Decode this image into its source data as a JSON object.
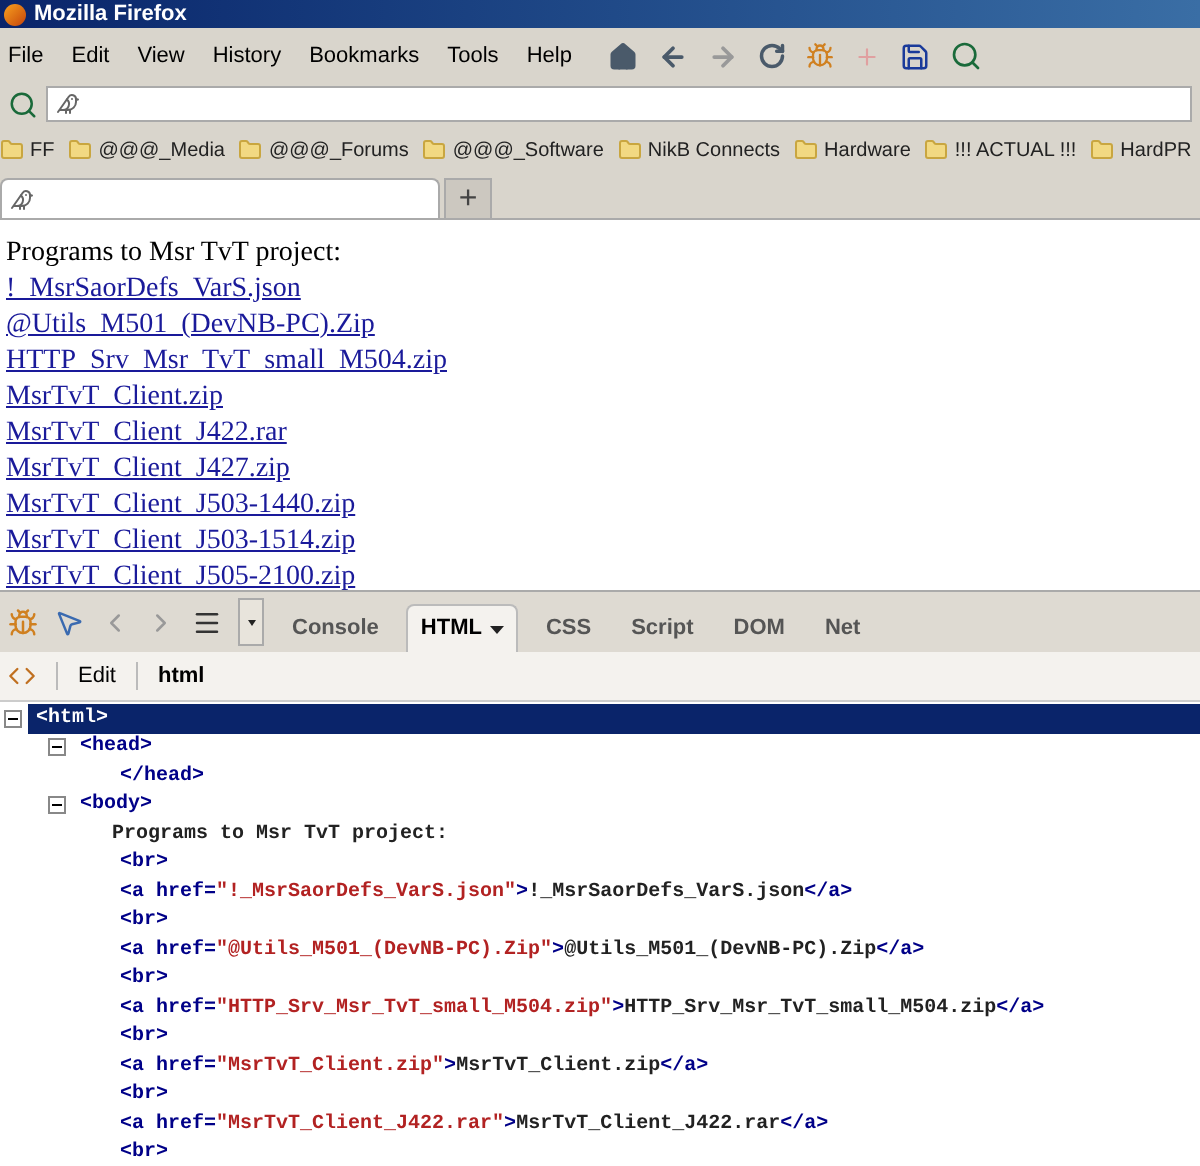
{
  "window": {
    "title": "Mozilla Firefox"
  },
  "menu": [
    "File",
    "Edit",
    "View",
    "History",
    "Bookmarks",
    "Tools",
    "Help"
  ],
  "bookmarks": [
    "FF",
    "@@@_Media",
    "@@@_Forums",
    "@@@_Software",
    "NikB Connects",
    "Hardware",
    "!!! ACTUAL !!!",
    "HardPR"
  ],
  "new_tab": {
    "label": "+"
  },
  "page": {
    "heading": "Programs to Msr TvT project:",
    "links": [
      "!_MsrSaorDefs_VarS.json",
      "@Utils_M501_(DevNB-PC).Zip",
      "HTTP_Srv_Msr_TvT_small_M504.zip",
      "MsrTvT_Client.zip",
      "MsrTvT_Client_J422.rar",
      "MsrTvT_Client_J427.zip",
      "MsrTvT_Client_J503-1440.zip",
      "MsrTvT_Client_J503-1514.zip",
      "MsrTvT_Client_J505-2100.zip"
    ]
  },
  "devtools": {
    "tabs": [
      {
        "label": "Console",
        "selected": false,
        "dropdown": false
      },
      {
        "label": "HTML",
        "selected": true,
        "dropdown": true
      },
      {
        "label": "CSS",
        "selected": false,
        "dropdown": false
      },
      {
        "label": "Script",
        "selected": false,
        "dropdown": false
      },
      {
        "label": "DOM",
        "selected": false,
        "dropdown": false
      },
      {
        "label": "Net",
        "selected": false,
        "dropdown": false
      }
    ],
    "edit_button": "Edit",
    "breadcrumb": "html",
    "tree": [
      {
        "kind": "element",
        "selected": true,
        "expanded": true,
        "line": [
          {
            "kind": "tag",
            "text": "<html>"
          }
        ],
        "children": [
          {
            "kind": "element",
            "selected": false,
            "expanded": true,
            "line": [
              {
                "kind": "tag",
                "text": "<head>"
              }
            ],
            "children": [
              {
                "kind": "leaf",
                "line": [
                  {
                    "kind": "tag",
                    "text": "</head>"
                  }
                ]
              }
            ]
          },
          {
            "kind": "element",
            "selected": false,
            "expanded": true,
            "line": [
              {
                "kind": "tag",
                "text": "<body>"
              }
            ],
            "children": [
              {
                "kind": "text",
                "line": [
                  {
                    "kind": "text",
                    "text": "Programs to Msr TvT project:"
                  }
                ]
              },
              {
                "kind": "leaf",
                "line": [
                  {
                    "kind": "tag",
                    "text": "<br>"
                  }
                ]
              },
              {
                "kind": "leaf",
                "line": [
                  {
                    "kind": "tag",
                    "text": "<a href="
                  },
                  {
                    "kind": "value",
                    "text": "\"!_MsrSaorDefs_VarS.json\""
                  },
                  {
                    "kind": "tag",
                    "text": ">"
                  },
                  {
                    "kind": "text",
                    "text": "!_MsrSaorDefs_VarS.json"
                  },
                  {
                    "kind": "tag",
                    "text": "</a>"
                  }
                ]
              },
              {
                "kind": "leaf",
                "line": [
                  {
                    "kind": "tag",
                    "text": "<br>"
                  }
                ]
              },
              {
                "kind": "leaf",
                "line": [
                  {
                    "kind": "tag",
                    "text": "<a href="
                  },
                  {
                    "kind": "value",
                    "text": "\"@Utils_M501_(DevNB-PC).Zip\""
                  },
                  {
                    "kind": "tag",
                    "text": ">"
                  },
                  {
                    "kind": "text",
                    "text": "@Utils_M501_(DevNB-PC).Zip"
                  },
                  {
                    "kind": "tag",
                    "text": "</a>"
                  }
                ]
              },
              {
                "kind": "leaf",
                "line": [
                  {
                    "kind": "tag",
                    "text": "<br>"
                  }
                ]
              },
              {
                "kind": "leaf",
                "line": [
                  {
                    "kind": "tag",
                    "text": "<a href="
                  },
                  {
                    "kind": "value",
                    "text": "\"HTTP_Srv_Msr_TvT_small_M504.zip\""
                  },
                  {
                    "kind": "tag",
                    "text": ">"
                  },
                  {
                    "kind": "text",
                    "text": "HTTP_Srv_Msr_TvT_small_M504.zip"
                  },
                  {
                    "kind": "tag",
                    "text": "</a>"
                  }
                ]
              },
              {
                "kind": "leaf",
                "line": [
                  {
                    "kind": "tag",
                    "text": "<br>"
                  }
                ]
              },
              {
                "kind": "leaf",
                "line": [
                  {
                    "kind": "tag",
                    "text": "<a href="
                  },
                  {
                    "kind": "value",
                    "text": "\"MsrTvT_Client.zip\""
                  },
                  {
                    "kind": "tag",
                    "text": ">"
                  },
                  {
                    "kind": "text",
                    "text": "MsrTvT_Client.zip"
                  },
                  {
                    "kind": "tag",
                    "text": "</a>"
                  }
                ]
              },
              {
                "kind": "leaf",
                "line": [
                  {
                    "kind": "tag",
                    "text": "<br>"
                  }
                ]
              },
              {
                "kind": "leaf",
                "line": [
                  {
                    "kind": "tag",
                    "text": "<a href="
                  },
                  {
                    "kind": "value",
                    "text": "\"MsrTvT_Client_J422.rar\""
                  },
                  {
                    "kind": "tag",
                    "text": ">"
                  },
                  {
                    "kind": "text",
                    "text": "MsrTvT_Client_J422.rar"
                  },
                  {
                    "kind": "tag",
                    "text": "</a>"
                  }
                ]
              },
              {
                "kind": "leaf",
                "line": [
                  {
                    "kind": "tag",
                    "text": "<br>"
                  }
                ]
              }
            ]
          }
        ]
      }
    ]
  }
}
